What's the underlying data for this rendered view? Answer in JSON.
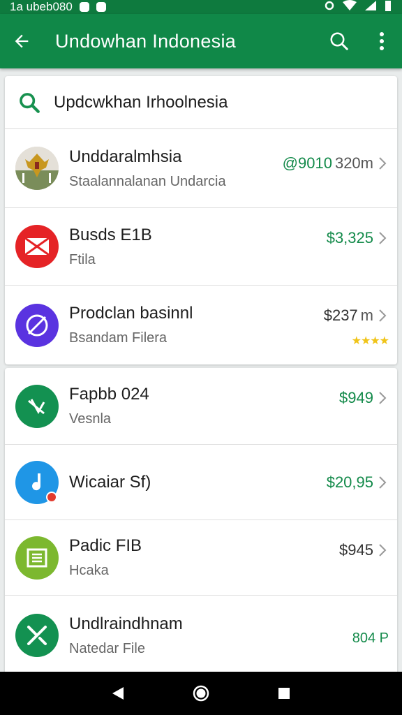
{
  "status_bar": {
    "left_text": "1a ubeb080",
    "right_icons": [
      "gear-icon",
      "wifi-icon",
      "signal-icon",
      "battery-icon"
    ]
  },
  "app_bar": {
    "title": "Undowhan Indonesia",
    "back_icon": "back-arrow-icon",
    "actions": [
      "search-icon",
      "more-vert-icon"
    ]
  },
  "search": {
    "query": "Updcwkhan Irhoolnesia",
    "icon": "search-icon"
  },
  "results_card_1": [
    {
      "name": "Unddaralmhsia",
      "subtitle": "Staalannalanan Undarcia",
      "price": "@9010",
      "distance": "320m",
      "icon": "emblem-icon"
    },
    {
      "name": "Busds E1B",
      "subtitle": "Ftila",
      "price": "$3,325",
      "icon": "mail-icon",
      "color": "#e52326"
    },
    {
      "name": "Prodclan basinnl",
      "subtitle": "Bsandam Filera",
      "price": "$237",
      "distance": "m",
      "rating": 4,
      "icon": "compass-icon",
      "color": "#5a33e0"
    }
  ],
  "results_card_2": [
    {
      "name": "Fapbb 024",
      "subtitle": "Vesnla",
      "price": "$949",
      "icon": "no-image-icon",
      "color": "#139151"
    },
    {
      "name": "Wicaiar Sf)",
      "subtitle": "",
      "price": "$20,95",
      "icon": "music-note-icon",
      "color": "#1f96e6"
    },
    {
      "name": "Padic FIB",
      "subtitle": "Hcaka",
      "price": "$945",
      "icon": "document-icon",
      "color": "#7cb82f"
    },
    {
      "name": "Undlraindhnam",
      "subtitle": "Natedar File",
      "price": "804 P",
      "icon": "tools-icon",
      "color": "#139151"
    }
  ],
  "nav_bar": [
    "back-triangle-icon",
    "home-circle-icon",
    "recents-square-icon"
  ],
  "colors": {
    "primary": "#108848",
    "status": "#0e7a3e",
    "price_green": "#138a4a",
    "star": "#f0c419"
  }
}
